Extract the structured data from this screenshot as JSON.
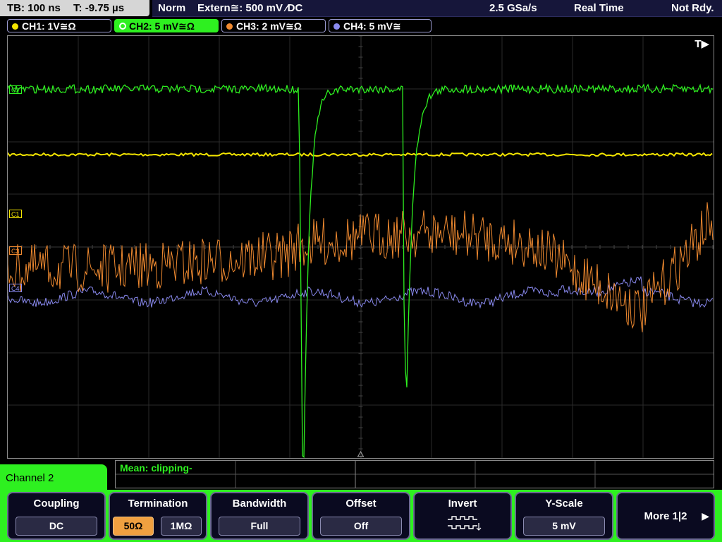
{
  "status": {
    "timebase": "TB: 100 ns",
    "trigger_pos": "T: -9.75 µs",
    "mode": "Norm",
    "trigger_source": "Extern≅: 500 mV ⁄DC",
    "sample_rate": "2.5 GSa/s",
    "acq_mode": "Real Time",
    "state": "Not Rdy."
  },
  "channels": [
    {
      "label": "CH1: 1V≅Ω",
      "color": "#f5e600"
    },
    {
      "label": "CH2: 5 mV≅Ω",
      "color": "#2ef020"
    },
    {
      "label": "CH3: 2 mV≅Ω",
      "color": "#f08a30"
    },
    {
      "label": "CH4: 5 mV≅",
      "color": "#8a8af0"
    }
  ],
  "trigger_marker": "T▶",
  "markers": {
    "c1": "C1",
    "c2": "C2",
    "c3": "C3",
    "c4": "C4"
  },
  "measurement": {
    "text": "Mean: clipping-"
  },
  "panel": {
    "title": "Channel 2"
  },
  "softkeys": {
    "coupling": {
      "title": "Coupling",
      "value": "DC"
    },
    "termination": {
      "title": "Termination",
      "opt1": "50Ω",
      "opt2": "1MΩ"
    },
    "bandwidth": {
      "title": "Bandwidth",
      "value": "Full"
    },
    "offset": {
      "title": "Offset",
      "value": "Off"
    },
    "invert": {
      "title": "Invert"
    },
    "yscale": {
      "title": "Y-Scale",
      "value": "5 mV"
    },
    "more": {
      "title": "More 1|2",
      "arrow": "▶"
    }
  },
  "colors": {
    "accent": "#2ef020",
    "ch1": "#f5e600",
    "ch2": "#2ef020",
    "ch3": "#f08a30",
    "ch4": "#8a8af0"
  }
}
